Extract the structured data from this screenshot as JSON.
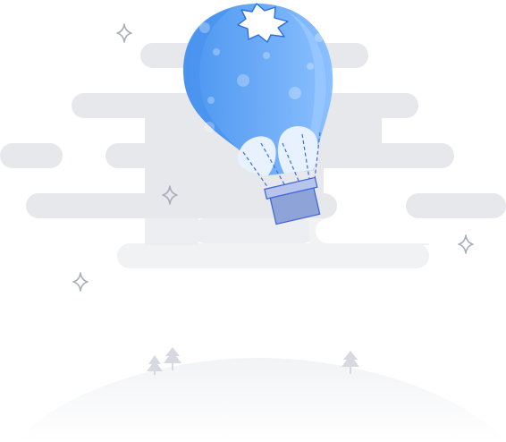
{
  "illustration": {
    "subject": "hot-air-balloon",
    "colors": {
      "balloon_main": "#5ba4f5",
      "balloon_light": "#8ec2ff",
      "balloon_dark": "#3f8fef",
      "cloud": "#e6e8ec",
      "cloud_light": "#f0f1f4",
      "basket": "#8fa3d6",
      "basket_stroke": "#3a62d9",
      "sparkle_stroke": "#aab0bb",
      "hill": "#f3f4f6",
      "tree": "#d9dce2"
    }
  }
}
